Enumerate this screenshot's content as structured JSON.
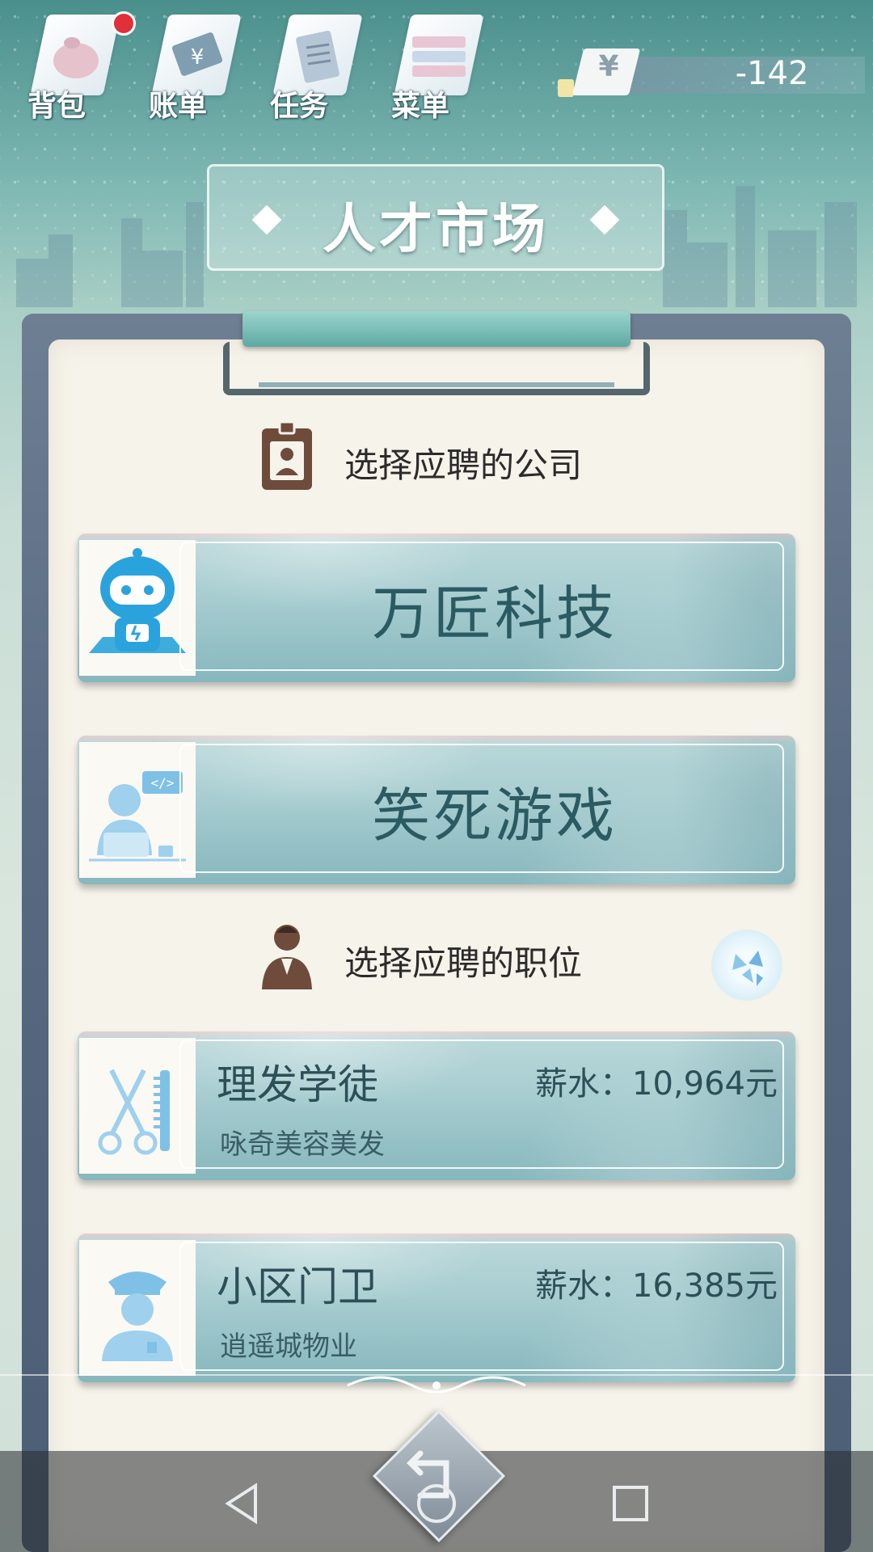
{
  "nav": {
    "items": [
      {
        "label": "背包",
        "icon": "backpack-icon",
        "has_badge": true
      },
      {
        "label": "账单",
        "icon": "bill-icon"
      },
      {
        "label": "任务",
        "icon": "task-icon"
      },
      {
        "label": "菜单",
        "icon": "menu-icon"
      }
    ]
  },
  "money": {
    "currency_symbol": "¥",
    "value": "-142"
  },
  "page": {
    "title": "人才市场"
  },
  "company_section": {
    "heading": "选择应聘的公司",
    "companies": [
      {
        "name": "万匠科技",
        "icon": "robot-icon"
      },
      {
        "name": "笑死游戏",
        "icon": "programmer-icon"
      }
    ]
  },
  "job_section": {
    "heading": "选择应聘的职位",
    "jobs": [
      {
        "title": "理发学徒",
        "salary": "薪水：10,964元",
        "company": "咏奇美容美发",
        "icon": "scissors-comb-icon"
      },
      {
        "title": "小区门卫",
        "salary": "薪水：16,385元",
        "company": "逍遥城物业",
        "icon": "security-guard-icon"
      }
    ]
  },
  "colors": {
    "card_text": "#2c5a63",
    "badge": "#e0303a",
    "board": "#586a82"
  }
}
